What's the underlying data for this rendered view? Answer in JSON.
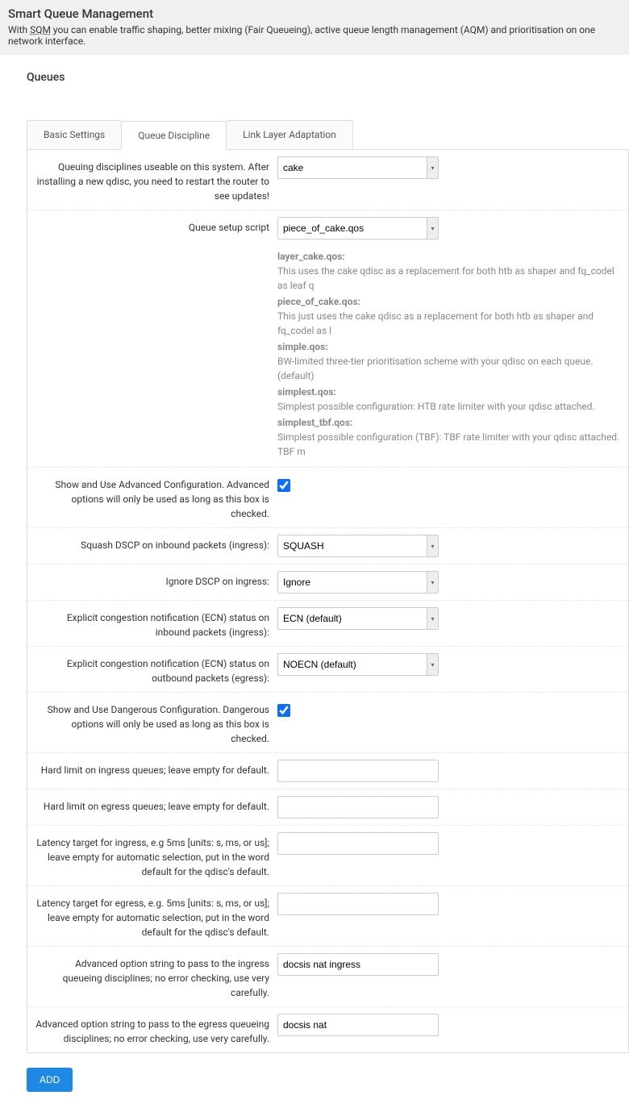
{
  "header": {
    "title": "Smart Queue Management",
    "desc_pre": "With ",
    "desc_link": "SQM",
    "desc_post": " you can enable traffic shaping, better mixing (Fair Queueing), active queue length management (AQM) and prioritisation on one network interface."
  },
  "section_title": "Queues",
  "tabs": {
    "basic": "Basic Settings",
    "discipline": "Queue Discipline",
    "linklayer": "Link Layer Adaptation"
  },
  "fields": {
    "qdisc_label": "Queuing disciplines useable on this system. After installing a new qdisc, you need to restart the router to see updates!",
    "qdisc_value": "cake",
    "script_label": "Queue setup script",
    "script_value": "piece_of_cake.qos",
    "adv_label": "Show and Use Advanced Configuration. Advanced options will only be used as long as this box is checked.",
    "squash_label": "Squash DSCP on inbound packets (ingress):",
    "squash_value": "SQUASH",
    "ignore_label": "Ignore DSCP on ingress:",
    "ignore_value": "Ignore",
    "ecn_in_label": "Explicit congestion notification (ECN) status on inbound packets (ingress):",
    "ecn_in_value": "ECN (default)",
    "ecn_out_label": "Explicit congestion notification (ECN) status on outbound packets (egress):",
    "ecn_out_value": "NOECN (default)",
    "danger_label": "Show and Use Dangerous Configuration. Dangerous options will only be used as long as this box is checked.",
    "hard_in_label": "Hard limit on ingress queues; leave empty for default.",
    "hard_out_label": "Hard limit on egress queues; leave empty for default.",
    "lat_in_label": "Latency target for ingress, e.g 5ms [units: s, ms, or us]; leave empty for automatic selection, put in the word default for the qdisc's default.",
    "lat_out_label": "Latency target for egress, e.g. 5ms [units: s, ms, or us]; leave empty for automatic selection, put in the word default for the qdisc's default.",
    "advopt_in_label": "Advanced option string to pass to the ingress queueing disciplines; no error checking, use very carefully.",
    "advopt_in_value": "docsis nat ingress",
    "advopt_out_label": "Advanced option string to pass to the egress queueing disciplines; no error checking, use very carefully.",
    "advopt_out_value": "docsis nat"
  },
  "help": {
    "layer_title": "layer_cake.qos:",
    "layer_text": "This uses the cake qdisc as a replacement for both htb as shaper and fq_codel as leaf q",
    "piece_title": "piece_of_cake.qos:",
    "piece_text": "This just uses the cake qdisc as a replacement for both htb as shaper and fq_codel as l",
    "simple_title": "simple.qos:",
    "simple_text": "BW-limited three-tier prioritisation scheme with your qdisc on each queue. (default)",
    "simplest_title": "simplest.qos:",
    "simplest_text": "Simplest possible configuration: HTB rate limiter with your qdisc attached.",
    "tbf_title": "simplest_tbf.qos:",
    "tbf_text": "Simplest possible configuration (TBF): TBF rate limiter with your qdisc attached. TBF m"
  },
  "add_label": "ADD"
}
